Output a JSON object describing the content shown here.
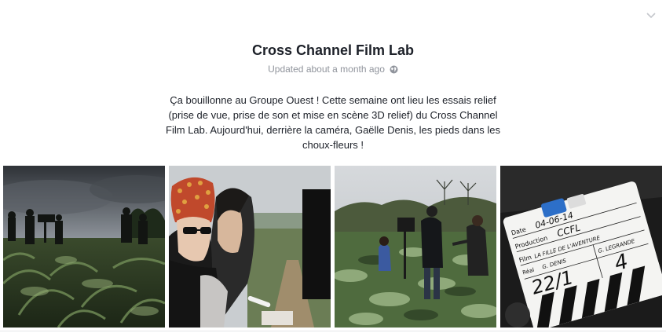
{
  "post": {
    "title": "Cross Channel Film Lab",
    "updated": "Updated about a month ago",
    "privacy_icon": "globe-icon",
    "text": "Ça bouillonne au Groupe Ouest ! Cette semaine ont lieu les essais relief (prise de vue, prise de son et mise en scène 3D relief) du Cross Channel Film Lab. Aujourd'hui, derrière la caméra, Gaëlle Denis, les pieds dans les choux-fleurs !"
  },
  "menu_icon": "chevron-down-icon",
  "photos": [
    {
      "name": "photo-film-crew-field"
    },
    {
      "name": "photo-director-sunglasses"
    },
    {
      "name": "photo-camera-operator-field"
    },
    {
      "name": "photo-clapperboard"
    }
  ],
  "clapperboard": {
    "date_label": "Date",
    "date": "04-06-14",
    "production_label": "Production",
    "production": "CCFL",
    "film_label": "Film",
    "film": "LA FILLE DE L'AVENTURE",
    "director_label": "Réal",
    "director": "G. DENIS",
    "operator": "G. LEGRANDE",
    "scene": "22/1",
    "take": "4"
  },
  "colors": {
    "title": "#1d2129",
    "meta": "#90949c",
    "divider": "#e5e6e9"
  }
}
